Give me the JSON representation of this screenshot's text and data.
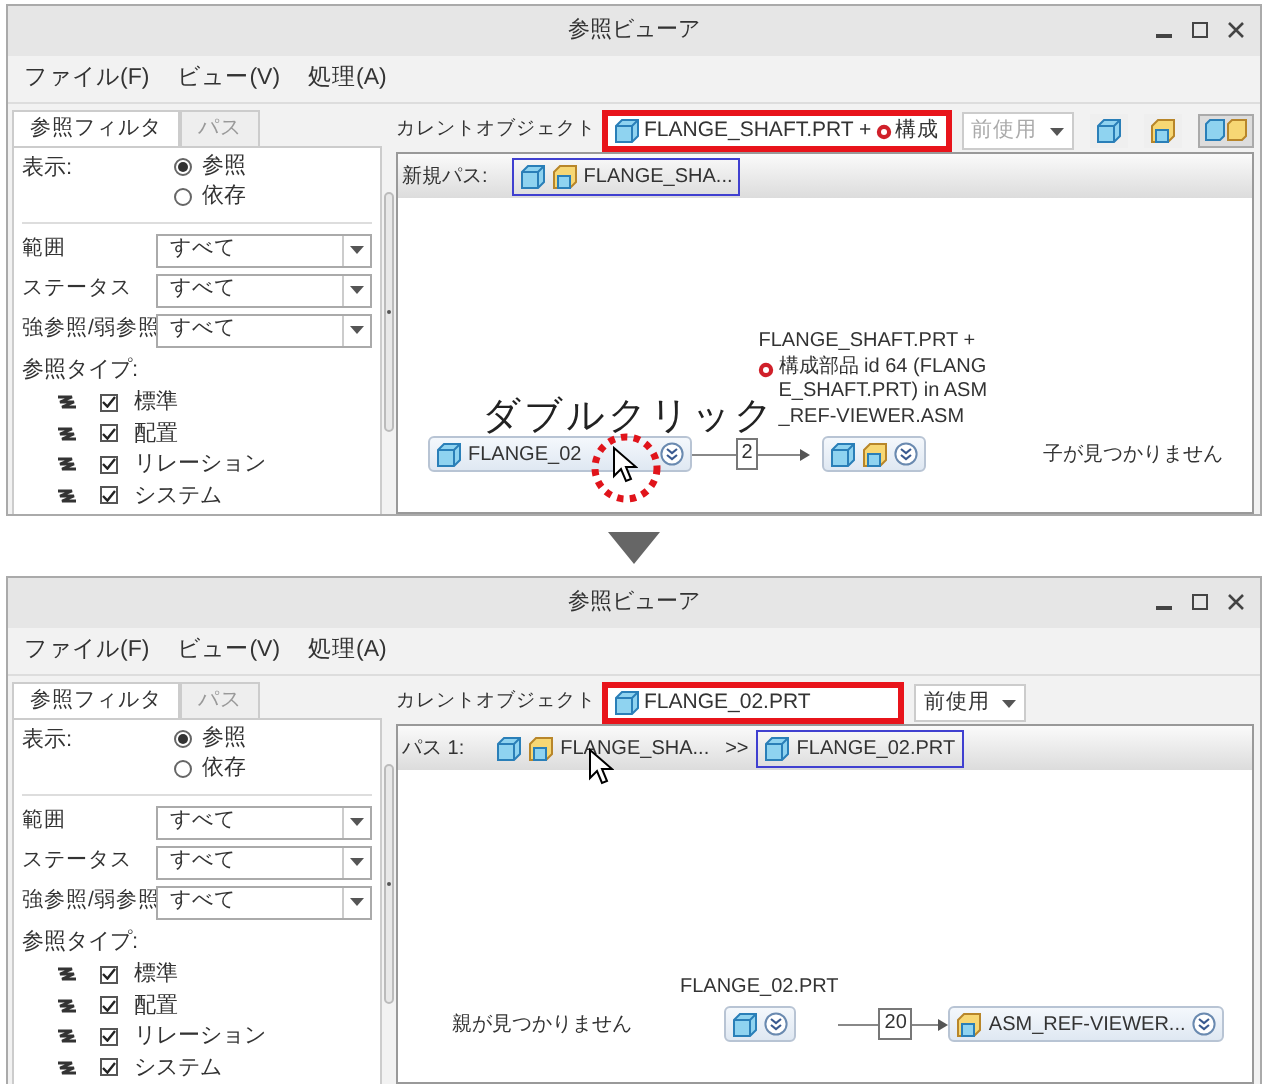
{
  "screens": [
    {
      "window": {
        "title": "参照ビューア"
      },
      "menu": [
        "ファイル(F)",
        "ビュー(V)",
        "処理(A)"
      ],
      "filter_tabs": [
        {
          "label": "参照フィルタ",
          "selected": true
        },
        {
          "label": "パス",
          "selected": false
        }
      ],
      "display": {
        "label": "表示:",
        "options": [
          {
            "label": "参照",
            "selected": true
          },
          {
            "label": "依存",
            "selected": false
          }
        ]
      },
      "filters": [
        {
          "label": "範囲",
          "value": "すべて"
        },
        {
          "label": "ステータス",
          "value": "すべて"
        },
        {
          "label": "強参照/弱参照",
          "value": "すべて"
        }
      ],
      "ref_types": {
        "label": "参照タイプ:",
        "items": [
          {
            "label": "標準",
            "checked": true
          },
          {
            "label": "配置",
            "checked": true
          },
          {
            "label": "リレーション",
            "checked": true
          },
          {
            "label": "システム",
            "checked": true
          }
        ]
      },
      "current_object": {
        "label": "カレントオブジェクト",
        "text": "FLANGE_SHAFT.PRT +",
        "marker": true,
        "suffix": "構成",
        "highlighted": true
      },
      "history": {
        "label": "前使用",
        "disabled": true
      },
      "view_buttons": [
        {
          "kind": "part",
          "selected": false
        },
        {
          "kind": "assembly",
          "selected": false
        },
        {
          "kind": "both",
          "selected": true
        }
      ],
      "path": {
        "label": "新規パス:",
        "crumbs": [
          {
            "icons": [
              {
                "kind": "part"
              },
              {
                "kind": "assembly"
              }
            ],
            "text": "FLANGE_SHA...",
            "highlighted": true
          }
        ]
      },
      "graph": {
        "message": {
          "kind": "child",
          "text": "子が見つかりません"
        },
        "source": {
          "icons": [
            {
              "kind": "part"
            }
          ],
          "text": "FLANGE_02"
        },
        "count": "2",
        "target": {
          "caption": "FLANGE_SHAFT.PRT +",
          "caption_marker": true,
          "caption_rest": "構成部品 id 64 (FLANGE_SHAFT.PRT) in ASM_REF-VIEWER.ASM",
          "icons": [
            {
              "kind": "part"
            },
            {
              "kind": "assembly"
            }
          ]
        }
      },
      "annotation": {
        "text": "ダブルクリック"
      }
    },
    {
      "window": {
        "title": "参照ビューア"
      },
      "menu": [
        "ファイル(F)",
        "ビュー(V)",
        "処理(A)"
      ],
      "filter_tabs": [
        {
          "label": "参照フィルタ",
          "selected": true
        },
        {
          "label": "パス",
          "selected": false
        }
      ],
      "display": {
        "label": "表示:",
        "options": [
          {
            "label": "参照",
            "selected": true
          },
          {
            "label": "依存",
            "selected": false
          }
        ]
      },
      "filters": [
        {
          "label": "範囲",
          "value": "すべて"
        },
        {
          "label": "ステータス",
          "value": "すべて"
        },
        {
          "label": "強参照/弱参照",
          "value": "すべて"
        }
      ],
      "ref_types": {
        "label": "参照タイプ:",
        "items": [
          {
            "label": "標準",
            "checked": true
          },
          {
            "label": "配置",
            "checked": true
          },
          {
            "label": "リレーション",
            "checked": true
          },
          {
            "label": "システム",
            "checked": true
          }
        ]
      },
      "current_object": {
        "label": "カレントオブジェクト",
        "text": "FLANGE_02.PRT",
        "highlighted": true
      },
      "history": {
        "label": "前使用",
        "disabled": false
      },
      "path": {
        "label": "パス 1:",
        "separator": ">>",
        "cursor": true,
        "crumbs": [
          {
            "icons": [
              {
                "kind": "part"
              },
              {
                "kind": "assembly"
              }
            ],
            "text": "FLANGE_SHA...",
            "highlighted": false
          },
          {
            "icons": [
              {
                "kind": "part"
              }
            ],
            "text": "FLANGE_02.PRT",
            "highlighted": true
          }
        ]
      },
      "graph": {
        "message": {
          "kind": "parent",
          "text": "親が見つかりません"
        },
        "source": {
          "caption": "FLANGE_02.PRT",
          "icons": [
            {
              "kind": "part"
            }
          ]
        },
        "count": "20",
        "target": {
          "icons": [
            {
              "kind": "assembly"
            }
          ],
          "text": "ASM_REF-VIEWER..."
        }
      }
    }
  ]
}
